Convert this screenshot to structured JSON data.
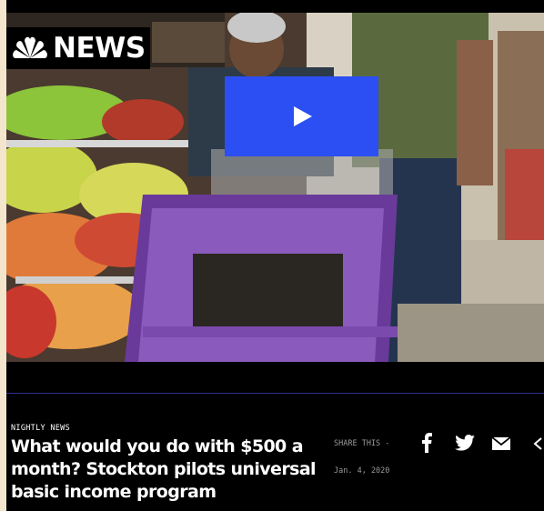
{
  "player": {
    "brand_text": "NEWS",
    "brand_icon": "nbc-peacock-icon",
    "play_icon": "play-icon",
    "play_color": "#2b4ff2"
  },
  "article": {
    "eyebrow": "NIGHTLY NEWS",
    "headline": "What would you do with $500 a month? Stockton pilots universal basic income program",
    "share_label": "SHARE THIS -",
    "date": "Jan. 4, 2020"
  },
  "share_icons": [
    "facebook-icon",
    "twitter-icon",
    "email-icon",
    "embed-icon"
  ]
}
